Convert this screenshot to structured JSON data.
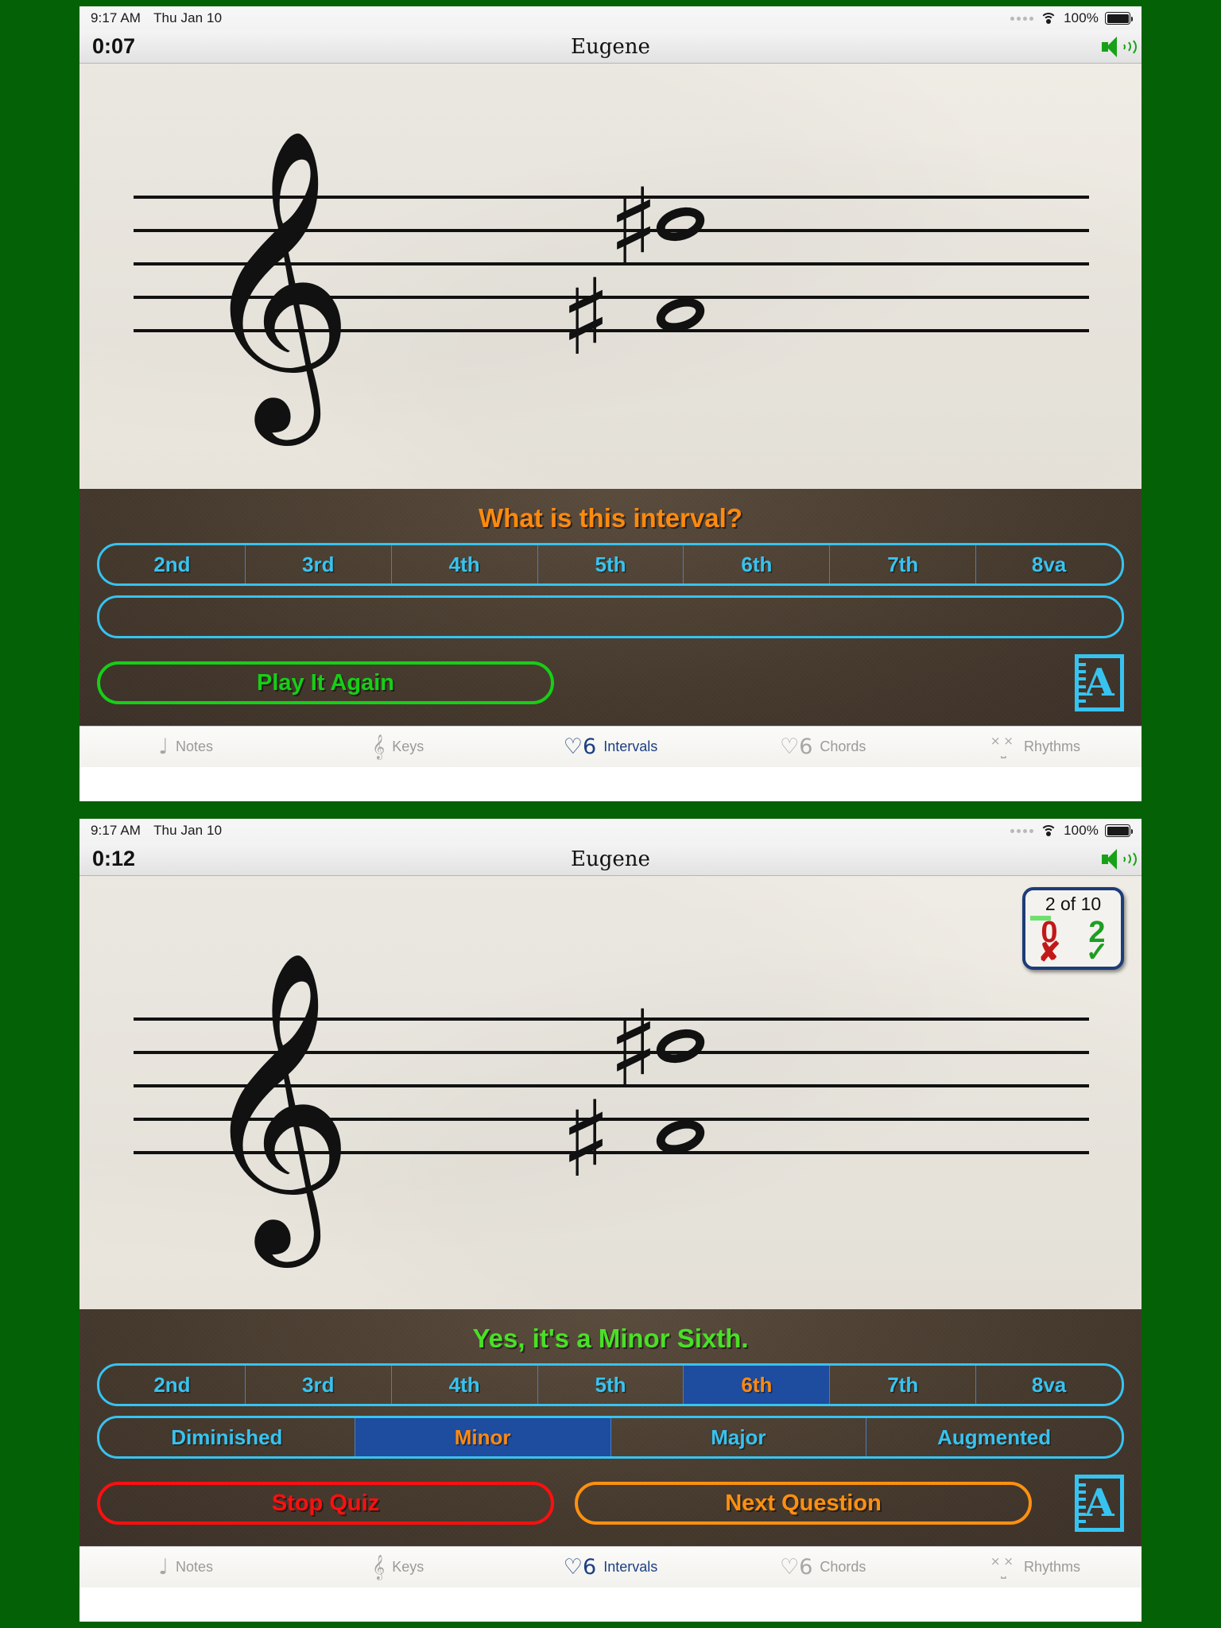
{
  "statusbar": {
    "time": "9:17 AM",
    "date": "Thu Jan 10",
    "battery_pct": "100%",
    "wifi_icon": "wifi-icon",
    "battery_icon": "battery-icon"
  },
  "app": {
    "title": "Eugene",
    "speaker_icon": "speaker-icon"
  },
  "panel1": {
    "timer": "0:07",
    "prompt": "What is this interval?",
    "prompt_color": "#ff8a0e",
    "intervals": [
      "2nd",
      "3rd",
      "4th",
      "5th",
      "6th",
      "7th",
      "8va"
    ],
    "qualities": [],
    "buttons": {
      "play_again": "Play It Again"
    },
    "book_icon_letter": "A"
  },
  "panel2": {
    "timer": "0:12",
    "prompt": "Yes, it's a Minor Sixth.",
    "prompt_color": "#49e026",
    "intervals": [
      "2nd",
      "3rd",
      "4th",
      "5th",
      "6th",
      "7th",
      "8va"
    ],
    "selected_interval": "6th",
    "qualities": [
      "Diminished",
      "Minor",
      "Major",
      "Augmented"
    ],
    "selected_quality": "Minor",
    "score": {
      "progress": "2 of 10",
      "wrong_count": "0",
      "wrong_mark": "✘",
      "right_count": "2",
      "right_mark": "✓"
    },
    "buttons": {
      "stop_quiz": "Stop Quiz",
      "next_question": "Next Question"
    },
    "book_icon_letter": "A"
  },
  "tabbar": {
    "items": [
      {
        "label": "Notes",
        "glyph": "♩",
        "icon": "quarter-note-icon",
        "active": false
      },
      {
        "label": "Keys",
        "glyph": "𝄞",
        "icon": "treble-clef-icon",
        "active": false
      },
      {
        "label": "Intervals",
        "glyph": "♡6",
        "icon": "interval-icon",
        "active": true
      },
      {
        "label": "Chords",
        "glyph": "♡6",
        "icon": "chord-icon",
        "active": false
      },
      {
        "label": "Rhythms",
        "glyph": "××",
        "icon": "rhythm-icon",
        "active": false
      }
    ],
    "active_color": "#1c3f82",
    "inactive_color": "#9a9a9a"
  },
  "score_notation": {
    "clef": "treble",
    "notes": [
      {
        "name": "lower-note",
        "accidental": "sharp",
        "staff_position": "middle-line"
      },
      {
        "name": "upper-note",
        "accidental": "sharp",
        "staff_position": "top-line"
      }
    ]
  },
  "colors": {
    "background": "#056105",
    "panel": "#473c30",
    "accent_blue": "#37c3f0",
    "selected_blue": "#1e4c9e",
    "orange": "#ff8a0e",
    "green": "#16cf16",
    "red": "#ff0f0f"
  }
}
